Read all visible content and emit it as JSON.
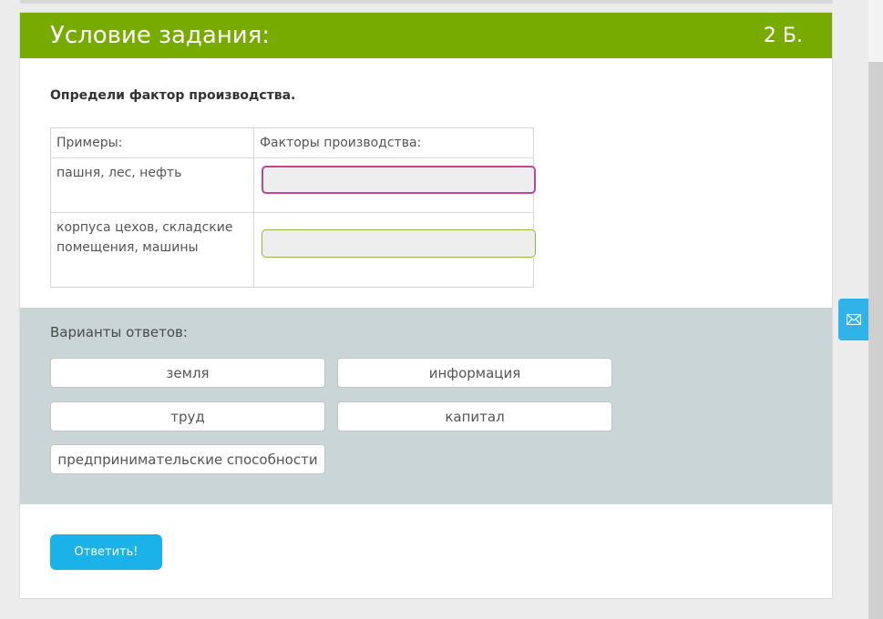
{
  "header": {
    "title": "Условие задания:",
    "points": "2 Б."
  },
  "question": "Определи фактор производства.",
  "table": {
    "headers": [
      "Примеры:",
      "Факторы производства:"
    ],
    "rows": [
      {
        "example": "пашня, лес, нефть",
        "answer": ""
      },
      {
        "example": "корпуса цехов, складские помещения, машины",
        "answer": ""
      }
    ]
  },
  "answers": {
    "title": "Варианты ответов:",
    "options": [
      "земля",
      "информация",
      "труд",
      "капитал",
      "предпринимательские способности"
    ]
  },
  "submit_label": "Ответить!",
  "icons": {
    "feedback": "mail-icon"
  },
  "colors": {
    "header_green": "#78ab00",
    "answers_bg": "#c9d5d6",
    "submit_blue": "#1bb1e9",
    "drop_border_1": "#c2459c",
    "drop_border_2": "#8ab940"
  }
}
